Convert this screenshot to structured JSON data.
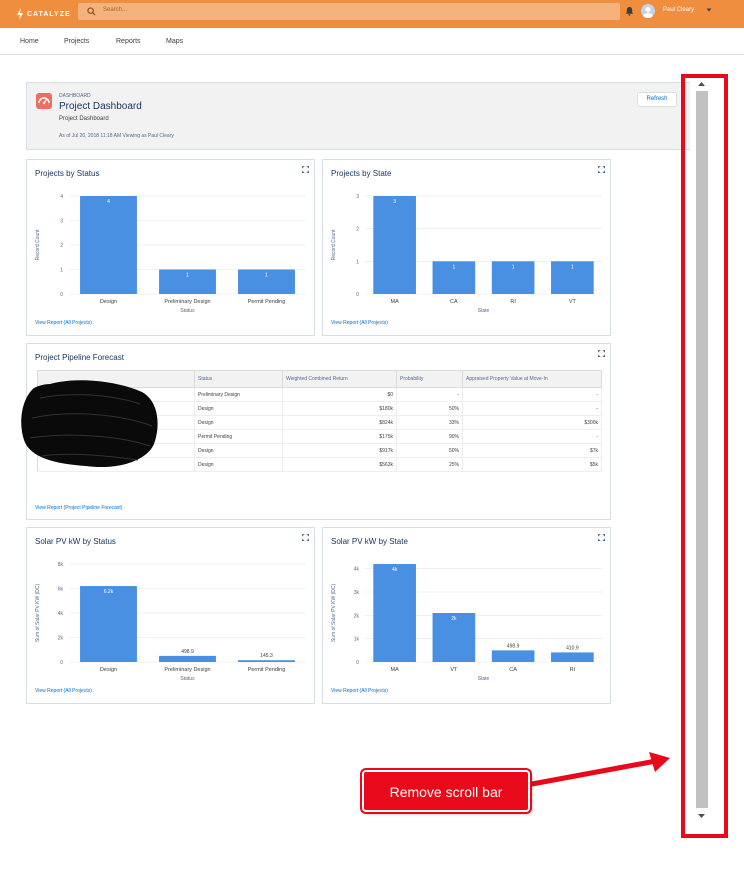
{
  "app": {
    "brand": "CATALYZE",
    "search_placeholder": "Search...",
    "user_name": "Paul Cleary"
  },
  "nav": {
    "items": [
      "Home",
      "Projects",
      "Reports",
      "Maps"
    ]
  },
  "dashboard": {
    "kicker": "DASHBOARD",
    "title": "Project Dashboard",
    "subtitle": "Project Dashboard",
    "as_of": "As of Jul 20, 2018 11:18 AM Viewing as Paul Cleary",
    "refresh_label": "Refresh"
  },
  "cards": {
    "projects_by_status": {
      "title": "Projects by Status",
      "link": "View Report (All Projects)"
    },
    "projects_by_state": {
      "title": "Projects by State",
      "link": "View Report (All Projects)"
    },
    "pipeline": {
      "title": "Project Pipeline Forecast",
      "link": "View Report (Project Pipeline Forecast)"
    },
    "solar_by_status": {
      "title": "Solar PV kW by Status",
      "link": "View Report (All Projects)"
    },
    "solar_by_state": {
      "title": "Solar PV kW by State",
      "link": "View Report (All Projects)"
    }
  },
  "pipeline_table": {
    "columns": [
      "",
      "Status",
      "Weighted Combined Return",
      "Probability",
      "Appraised Property Value at Move-In"
    ],
    "rows": [
      [
        "",
        "Preliminary Design",
        "$0",
        "-",
        "-"
      ],
      [
        "",
        "Design",
        "$180k",
        "50%",
        "-"
      ],
      [
        "",
        "Design",
        "$824k",
        "33%",
        "$300k"
      ],
      [
        "",
        "Permit Pending",
        "$175k",
        "90%",
        "-"
      ],
      [
        "",
        "Design",
        "$917k",
        "50%",
        "$7k"
      ],
      [
        "",
        "Design",
        "$563k",
        "25%",
        "$5k"
      ]
    ]
  },
  "chart_data": [
    {
      "type": "bar",
      "title": "Projects by Status",
      "categories": [
        "Design",
        "Preliminary Design",
        "Permit Pending"
      ],
      "values": [
        4,
        1,
        1
      ],
      "value_labels": [
        "4",
        "1",
        "1"
      ],
      "xlabel": "Status",
      "ylabel": "Record Count",
      "ylim": [
        0,
        4
      ],
      "yticks": [
        "0",
        "1",
        "2",
        "3",
        "4"
      ],
      "color": "#4a90e2"
    },
    {
      "type": "bar",
      "title": "Projects by State",
      "categories": [
        "MA",
        "CA",
        "RI",
        "VT"
      ],
      "values": [
        3,
        1,
        1,
        1
      ],
      "value_labels": [
        "3",
        "1",
        "1",
        "1"
      ],
      "xlabel": "State",
      "ylabel": "Record Count",
      "ylim": [
        0,
        3
      ],
      "yticks": [
        "0",
        "1",
        "2",
        "3"
      ],
      "color": "#4a90e2"
    },
    {
      "type": "bar",
      "title": "Solar PV kW by Status",
      "categories": [
        "Design",
        "Preliminary Design",
        "Permit Pending"
      ],
      "values": [
        6200,
        498.9,
        145.3
      ],
      "value_labels": [
        "6.2k",
        "498.9",
        "145.3"
      ],
      "xlabel": "Status",
      "ylabel": "Sum of Solar PV KW (DC)",
      "ylim": [
        0,
        8000
      ],
      "yticks": [
        "0",
        "2k",
        "4k",
        "6k",
        "8k"
      ],
      "color": "#4a90e2"
    },
    {
      "type": "bar",
      "title": "Solar PV kW by State",
      "categories": [
        "MA",
        "VT",
        "CA",
        "RI"
      ],
      "values": [
        4200,
        2100,
        498.9,
        410.9
      ],
      "value_labels": [
        "4k",
        "2k",
        "498.9",
        "410.9"
      ],
      "xlabel": "State",
      "ylabel": "Sum of Solar PV KW (DC)",
      "ylim": [
        0,
        4200
      ],
      "yticks": [
        "0",
        "1k",
        "2k",
        "3k",
        "4k"
      ],
      "color": "#4a90e2"
    }
  ],
  "annotation": {
    "callout_text": "Remove scroll bar",
    "color": "#e8091a"
  }
}
